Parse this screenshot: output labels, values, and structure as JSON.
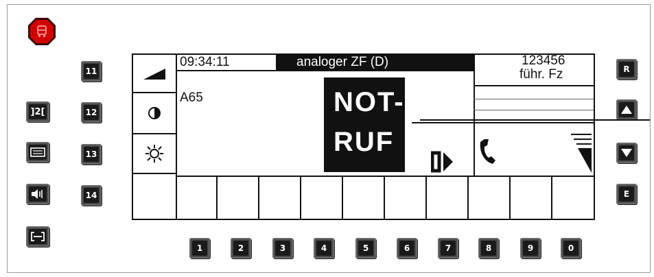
{
  "status_bar": {
    "time": "09:34:11",
    "mode": "analoger ZF (D)",
    "vehicle_id": "123456",
    "vehicle_role": "führ. Fz"
  },
  "line": "A65",
  "alert": {
    "line1": "NOT-",
    "line2": "RUF"
  },
  "left_keys": [
    {
      "label": "11"
    },
    {
      "label": "12"
    },
    {
      "label": "13"
    },
    {
      "label": "14"
    }
  ],
  "side_icon_keys": [
    {
      "label": "]2["
    },
    {
      "icon": "display-icon"
    },
    {
      "icon": "speaker-icon"
    },
    {
      "icon": "link-icon"
    }
  ],
  "right_keys": [
    {
      "label": "R"
    },
    {
      "icon": "arrow-up-icon"
    },
    {
      "icon": "arrow-down-icon"
    },
    {
      "label": "E"
    }
  ],
  "number_keys": [
    "1",
    "2",
    "3",
    "4",
    "5",
    "6",
    "7",
    "8",
    "9",
    "0"
  ],
  "display_controls": [
    {
      "icon": "volume-ramp-icon"
    },
    {
      "icon": "contrast-icon"
    },
    {
      "icon": "brightness-icon"
    }
  ],
  "colors": {
    "key_face": "#1a1a1a",
    "emergency": "#c00000",
    "display_ink": "#111111"
  }
}
